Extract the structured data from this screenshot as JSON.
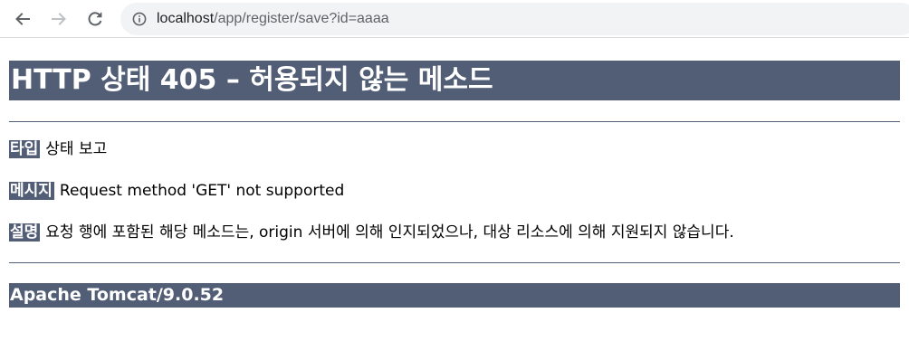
{
  "browser": {
    "url_host": "localhost",
    "url_path": "/app/register/save?id=aaaa"
  },
  "page": {
    "title": "HTTP 상태 405 – 허용되지 않는 메소드",
    "type_label": "타입",
    "type_value": "상태 보고",
    "message_label": "메시지",
    "message_value": "Request method 'GET' not supported",
    "description_label": "설명",
    "description_value": "요청 행에 포함된 해당 메소드는, origin 서버에 의해 인지되었으나, 대상 리소스에 의해 지원되지 않습니다.",
    "footer": "Apache Tomcat/9.0.52"
  },
  "colors": {
    "header_bg": "#525d76",
    "omnibox_bg": "#f1f3f4"
  },
  "icons": {
    "back": "arrow-left-icon",
    "forward": "arrow-right-icon",
    "reload": "reload-icon",
    "site_info": "info-icon"
  }
}
